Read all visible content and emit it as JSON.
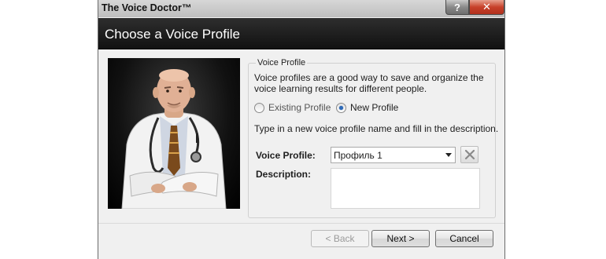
{
  "window": {
    "app_title": "The Voice Doctor™",
    "help_label": "?",
    "close_label": "✕"
  },
  "header": {
    "title": "Choose a Voice Profile"
  },
  "group": {
    "legend": "Voice Profile",
    "intro": "Voice profiles are a good way to save and organize the voice learning results for different people."
  },
  "mode": {
    "existing_label": "Existing Profile",
    "new_label": "New Profile",
    "selected": "new"
  },
  "form": {
    "hint": "Type in a new voice profile name and fill in the description.",
    "profile_label": "Voice Profile:",
    "profile_value": "Профиль 1",
    "description_label": "Description:",
    "description_value": ""
  },
  "buttons": {
    "back": "< Back",
    "next": "Next >",
    "cancel": "Cancel"
  },
  "colors": {
    "header_bg": "#111111",
    "accent": "#2d6ab8",
    "close_red": "#c7412a"
  }
}
